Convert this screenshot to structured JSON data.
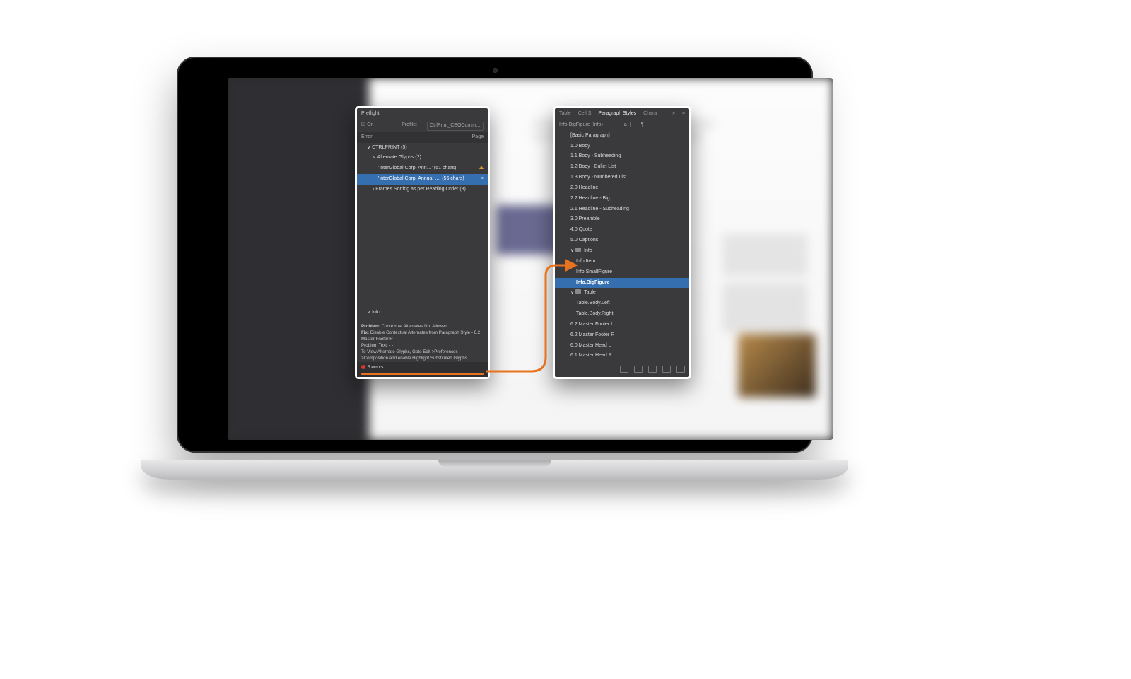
{
  "preflight": {
    "title": "Preflight",
    "on_label": "On",
    "profile_label": "Profile:",
    "profile_value": "CtrlPrint_CEOComm…",
    "col_error": "Error",
    "col_page": "Page",
    "tree": {
      "root": "CTRLPRINT (5)",
      "group1": "Alternate Glyphs (2)",
      "item1": "'InterGlobal Corp. Ann…' (51 chars)",
      "item2_sel": "'InterGlobal Corp. Annual …' (56 chars)",
      "group2": "Frames Sorting as per Reading Order (3)"
    },
    "info_toggle": "Info",
    "problem_label": "Problem:",
    "problem_text": "Contextual Alternates Not Allowed",
    "fix_label": "Fix:",
    "fix_text": "Disable Contextual Alternates from Paragraph Style - 6.2 Master Footer R",
    "pt_label": "Problem Text: - -",
    "view_text": "To View Alternate Glyphs, Goto Edit >Preferences >Composition and enable Highlight Substituted Glyphs",
    "errors": "5 errors"
  },
  "styles": {
    "tabs": {
      "t1": "Table",
      "t2": "Cell S",
      "t3": "Paragraph Styles",
      "t4": "Chara"
    },
    "glyph1": "[a+]",
    "glyph2": "¶",
    "current": "Info.BigFigure (Info)",
    "list": [
      "[Basic Paragraph]",
      "1.0 Body",
      "1.1 Body - Subheading",
      "1.2 Body - Bullet List",
      "1.3 Body - Numbered List",
      "2.0 Headline",
      "2.2 Headline - Big",
      "2.1 Headline - Subheading",
      "3.0 Preamble",
      "4.0 Quote",
      "5.0 Captions"
    ],
    "folder_info": "Info",
    "info_items": [
      "Info.Item",
      "Info.SmallFigure",
      "Info.BigFigure"
    ],
    "folder_table": "Table",
    "table_items": [
      "Table.Body.Left",
      "Table.Body.Right"
    ],
    "tail": [
      "6.2 Master Footer L",
      "6.2 Master Footer R",
      "6.0 Master Head L",
      "6.1 Master Head R"
    ]
  }
}
